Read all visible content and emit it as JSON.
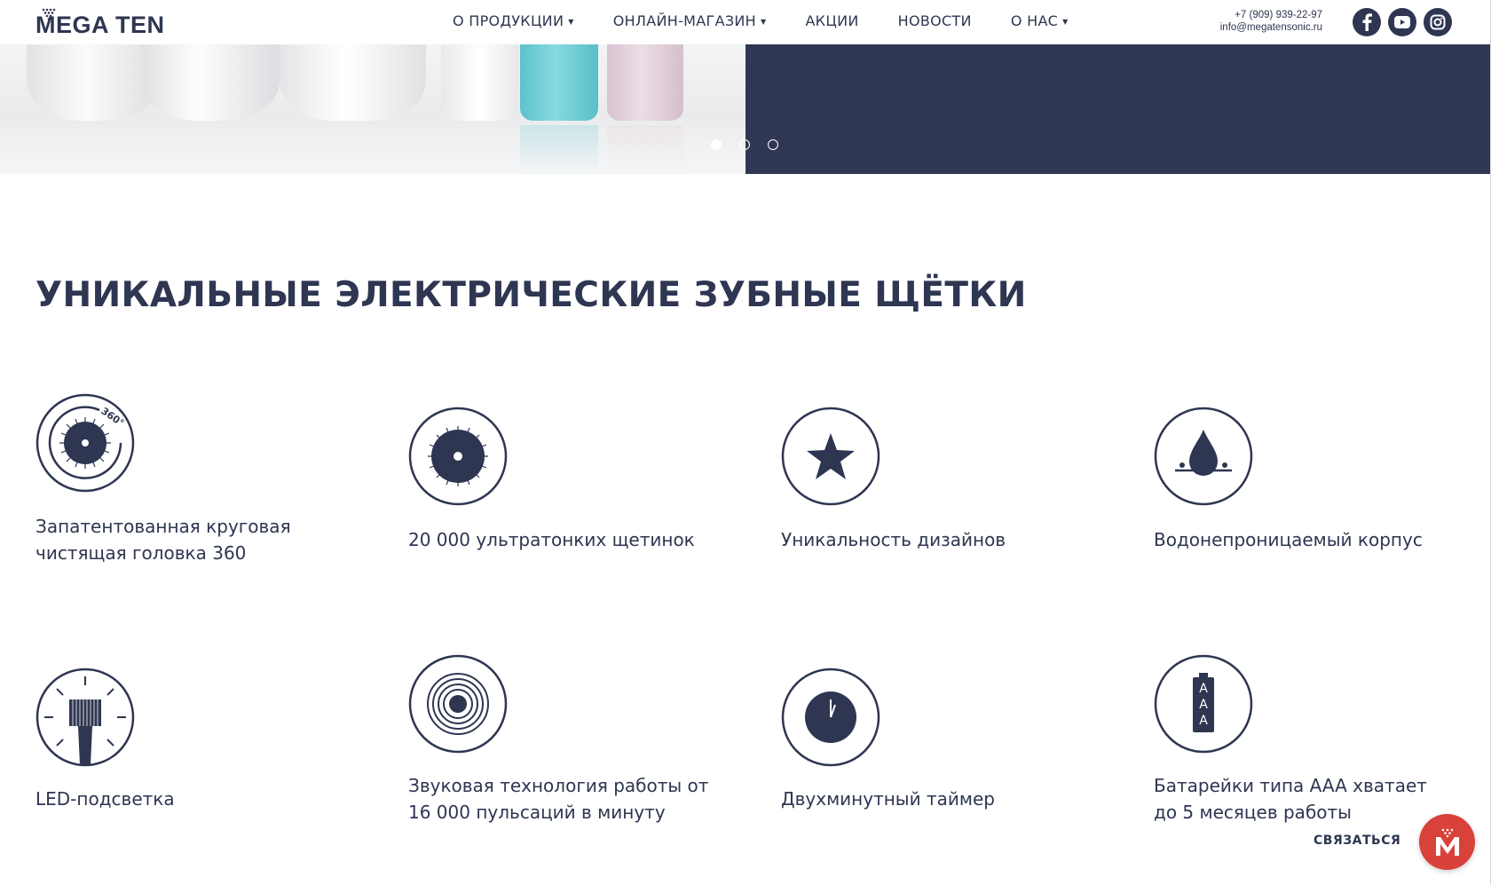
{
  "header": {
    "logo_text": "MEGA TEN",
    "nav": [
      {
        "label": "О ПРОДУКЦИИ",
        "dropdown": true
      },
      {
        "label": "ОНЛАЙН-МАГАЗИН",
        "dropdown": true
      },
      {
        "label": "АКЦИИ",
        "dropdown": false
      },
      {
        "label": "НОВОСТИ",
        "dropdown": false
      },
      {
        "label": "О НАС",
        "dropdown": true
      }
    ],
    "phone": "+7 (909) 939-22-97",
    "email": "info@megatensonic.ru",
    "socials": [
      "facebook-icon",
      "youtube-icon",
      "instagram-icon"
    ]
  },
  "hero": {
    "slides_total": 3,
    "active_slide": 1,
    "right_panel_color": "#303753"
  },
  "main": {
    "title": "УНИКАЛЬНЫЕ ЭЛЕКТРИЧЕСКИЕ ЗУБНЫЕ ЩЁТКИ",
    "features": [
      {
        "icon": "brush-head-360-icon",
        "icon_text": "360°",
        "text": "Запатентованная круговая чистящая головка 360"
      },
      {
        "icon": "bristles-icon",
        "text": "20 000 ультратонких щетинок"
      },
      {
        "icon": "star-icon",
        "text": "Уникальность дизайнов"
      },
      {
        "icon": "water-drop-icon",
        "text": "Водонепроницаемый корпус"
      },
      {
        "icon": "led-light-icon",
        "text": "LED-подсветка"
      },
      {
        "icon": "sound-waves-icon",
        "text": "Звуковая технология работы от 16 000 пульсаций в минуту"
      },
      {
        "icon": "timer-icon",
        "text": "Двухминутный таймер"
      },
      {
        "icon": "battery-icon",
        "icon_text": "AAA",
        "text": "Батарейки типа AAA хватает до 5 месяцев работы"
      }
    ]
  },
  "chat": {
    "label": "СВЯЗАТЬСЯ",
    "color": "#d9413b"
  },
  "colors": {
    "brand": "#2e3651",
    "accent": "#d9413b"
  }
}
